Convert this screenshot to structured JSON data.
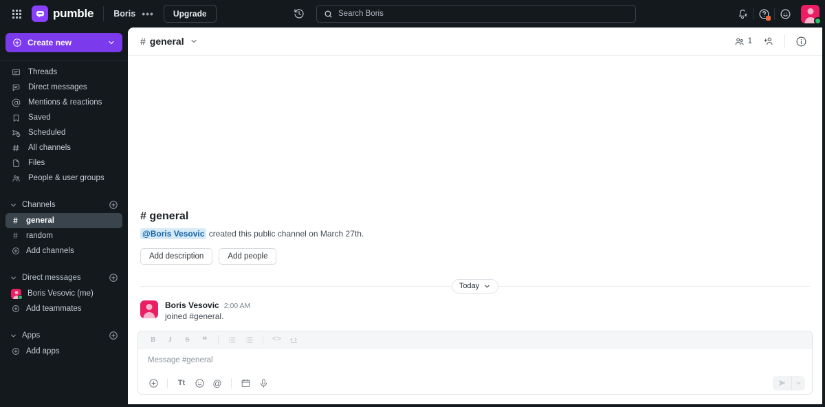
{
  "topbar": {
    "apps_icon": "grid-apps-icon",
    "brand": "pumble",
    "workspace": "Boris",
    "more_label": "•••",
    "upgrade_label": "Upgrade",
    "history_icon": "history-clock-icon",
    "search": {
      "icon": "search-icon",
      "placeholder": "Search Boris",
      "value": "Search Boris"
    },
    "notifications_icon": "bell-snooze-icon",
    "help_icon": "help-question-icon",
    "status_icon": "smiley-status-icon",
    "avatar": "user-avatar",
    "accent": "#7c3aed",
    "avatar_color": "#e91e63",
    "presence_color": "#27c46b",
    "badge_color": "#f0663a"
  },
  "sidebar": {
    "create_new": {
      "label": "Create new",
      "icon": "plus-circle-icon",
      "chevron": "chevron-down-icon"
    },
    "nav": [
      {
        "label": "Threads",
        "icon": "threads-icon"
      },
      {
        "label": "Direct messages",
        "icon": "direct-messages-icon"
      },
      {
        "label": "Mentions & reactions",
        "icon": "at-mention-icon"
      },
      {
        "label": "Saved",
        "icon": "bookmark-icon"
      },
      {
        "label": "Scheduled",
        "icon": "scheduled-send-icon"
      },
      {
        "label": "All channels",
        "icon": "all-channels-icon"
      },
      {
        "label": "Files",
        "icon": "file-icon"
      },
      {
        "label": "People & user groups",
        "icon": "people-icon"
      }
    ],
    "channels_section": {
      "label": "Channels",
      "items": [
        {
          "label": "general",
          "hash": "#",
          "active": true
        },
        {
          "label": "random",
          "hash": "#",
          "active": false
        }
      ],
      "add_label": "Add channels"
    },
    "dm_section": {
      "label": "Direct messages",
      "items": [
        {
          "label": "Boris Vesovic (me)"
        }
      ],
      "add_label": "Add teammates"
    },
    "apps_section": {
      "label": "Apps",
      "add_label": "Add apps"
    }
  },
  "channel_header": {
    "hash": "#",
    "name": "general",
    "members_count": "1",
    "members_icon": "members-icon",
    "add_member_icon": "add-person-icon",
    "info_icon": "info-circle-icon"
  },
  "intro": {
    "title": "# general",
    "mention": "@Boris Vesovic",
    "text": " created this public channel on March 27th.",
    "buttons": [
      {
        "label": "Add description"
      },
      {
        "label": "Add people"
      }
    ]
  },
  "divider": {
    "label": "Today"
  },
  "message": {
    "author": "Boris Vesovic",
    "time": "2:00 AM",
    "text": "joined #general."
  },
  "composer": {
    "placeholder": "Message #general",
    "toolbar": [
      {
        "name": "bold",
        "glyph": "B"
      },
      {
        "name": "italic",
        "glyph": "I"
      },
      {
        "name": "strikethrough",
        "glyph": "S"
      },
      {
        "name": "blockquote",
        "glyph": "❝"
      },
      {
        "name": "ordered-list",
        "glyph": ""
      },
      {
        "name": "bulleted-list",
        "glyph": ""
      },
      {
        "name": "inline-code",
        "glyph": "<>"
      },
      {
        "name": "code-block",
        "glyph": ""
      }
    ],
    "actions": [
      {
        "name": "attach-plus",
        "glyph": "+"
      },
      {
        "name": "text-format",
        "glyph": "Tt"
      },
      {
        "name": "emoji",
        "glyph": ""
      },
      {
        "name": "mention",
        "glyph": "@"
      },
      {
        "name": "schedule",
        "glyph": ""
      },
      {
        "name": "voice-record",
        "glyph": ""
      }
    ],
    "send_icon": "send-plane-icon",
    "send_options_icon": "chevron-down-icon"
  }
}
